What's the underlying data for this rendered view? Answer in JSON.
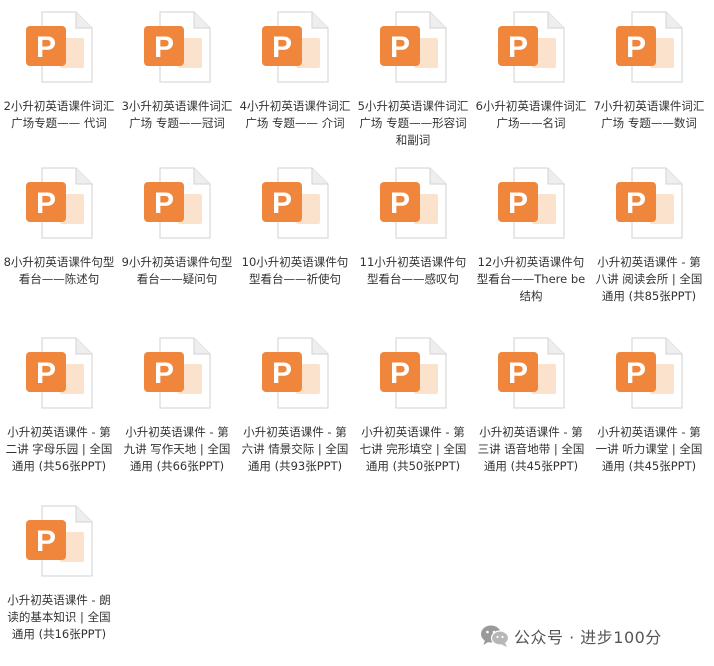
{
  "icon": "powerpoint-file-icon",
  "colors": {
    "badge": "#f0863c",
    "badge_text": "#ffffff",
    "page": "#ffffff",
    "page_border": "#d9d9d9",
    "fold": "#eeeeee",
    "slide_accent": "#fbe2cd"
  },
  "files": [
    {
      "badge_letter": "P",
      "label": "2小升初英语课件词汇广场专题—— 代词"
    },
    {
      "badge_letter": "P",
      "label": "3小升初英语课件词汇广场 专题——冠词"
    },
    {
      "badge_letter": "P",
      "label": "4小升初英语课件词汇广场 专题—— 介词"
    },
    {
      "badge_letter": "P",
      "label": "5小升初英语课件词汇广场 专题——形容词和副词"
    },
    {
      "badge_letter": "P",
      "label": "6小升初英语课件词汇广场——名词"
    },
    {
      "badge_letter": "P",
      "label": "7小升初英语课件词汇广场 专题——数词"
    },
    {
      "badge_letter": "P",
      "label": "8小升初英语课件句型看台——陈述句"
    },
    {
      "badge_letter": "P",
      "label": "9小升初英语课件句型看台——疑问句"
    },
    {
      "badge_letter": "P",
      "label": "10小升初英语课件句型看台——祈使句"
    },
    {
      "badge_letter": "P",
      "label": "11小升初英语课件句型看台——感叹句"
    },
    {
      "badge_letter": "P",
      "label": "12小升初英语课件句型看台——There be结构"
    },
    {
      "badge_letter": "P",
      "label": "小升初英语课件 - 第八讲 阅读会所 | 全国通用 (共85张PPT)"
    },
    {
      "badge_letter": "P",
      "label": "小升初英语课件 - 第二讲 字母乐园 | 全国通用 (共56张PPT)"
    },
    {
      "badge_letter": "P",
      "label": "小升初英语课件 - 第九讲 写作天地 | 全国通用 (共66张PPT)"
    },
    {
      "badge_letter": "P",
      "label": "小升初英语课件 - 第六讲 情景交际 | 全国通用 (共93张PPT)"
    },
    {
      "badge_letter": "P",
      "label": "小升初英语课件 - 第七讲 完形填空 | 全国通用 (共50张PPT)"
    },
    {
      "badge_letter": "P",
      "label": "小升初英语课件 - 第三讲 语音地带 | 全国通用 (共45张PPT)"
    },
    {
      "badge_letter": "P",
      "label": "小升初英语课件 - 第一讲 听力课堂 | 全国通用 (共45张PPT)"
    },
    {
      "badge_letter": "P",
      "label": "小升初英语课件 - 朗读的基本知识 | 全国通用 (共16张PPT)"
    }
  ],
  "watermark": {
    "icon": "wechat-icon",
    "text": "公众号 · 进步100分"
  }
}
